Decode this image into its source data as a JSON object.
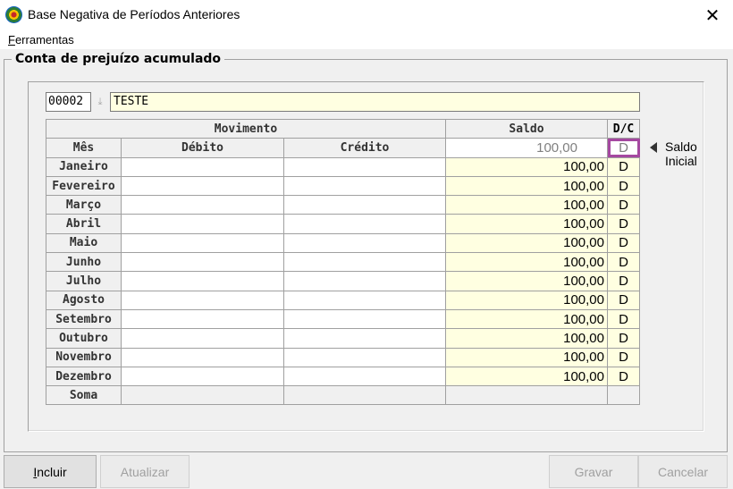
{
  "window": {
    "title": "Base Negativa de Períodos Anteriores",
    "close": "✕"
  },
  "menu": {
    "ferramentas_first": "F",
    "ferramentas_rest": "erramentas"
  },
  "group": {
    "title": "Conta de prejuízo acumulado"
  },
  "account": {
    "code": "00002",
    "name": "TESTE"
  },
  "grid": {
    "headers": {
      "movimento": "Movimento",
      "saldo": "Saldo",
      "dc": "D/C",
      "mes": "Mês",
      "debito": "Débito",
      "credito": "Crédito"
    },
    "initial": {
      "saldo": "100,00",
      "dc": "D"
    },
    "rows": [
      {
        "month": "Janeiro",
        "debito": "",
        "credito": "",
        "saldo": "100,00",
        "dc": "D"
      },
      {
        "month": "Fevereiro",
        "debito": "",
        "credito": "",
        "saldo": "100,00",
        "dc": "D"
      },
      {
        "month": "Março",
        "debito": "",
        "credito": "",
        "saldo": "100,00",
        "dc": "D"
      },
      {
        "month": "Abril",
        "debito": "",
        "credito": "",
        "saldo": "100,00",
        "dc": "D"
      },
      {
        "month": "Maio",
        "debito": "",
        "credito": "",
        "saldo": "100,00",
        "dc": "D"
      },
      {
        "month": "Junho",
        "debito": "",
        "credito": "",
        "saldo": "100,00",
        "dc": "D"
      },
      {
        "month": "Julho",
        "debito": "",
        "credito": "",
        "saldo": "100,00",
        "dc": "D"
      },
      {
        "month": "Agosto",
        "debito": "",
        "credito": "",
        "saldo": "100,00",
        "dc": "D"
      },
      {
        "month": "Setembro",
        "debito": "",
        "credito": "",
        "saldo": "100,00",
        "dc": "D"
      },
      {
        "month": "Outubro",
        "debito": "",
        "credito": "",
        "saldo": "100,00",
        "dc": "D"
      },
      {
        "month": "Novembro",
        "debito": "",
        "credito": "",
        "saldo": "100,00",
        "dc": "D"
      },
      {
        "month": "Dezembro",
        "debito": "",
        "credito": "",
        "saldo": "100,00",
        "dc": "D"
      }
    ],
    "soma": "Soma"
  },
  "saldo_inicial": {
    "line1": "Saldo",
    "line2": "Inicial"
  },
  "buttons": {
    "incluir_first": "I",
    "incluir_rest": "ncluir",
    "atualizar": "Atualizar",
    "gravar": "Gravar",
    "cancelar": "Cancelar"
  },
  "colors": {
    "highlight_border": "#a548a0",
    "input_yellow": "#ffffe1"
  }
}
